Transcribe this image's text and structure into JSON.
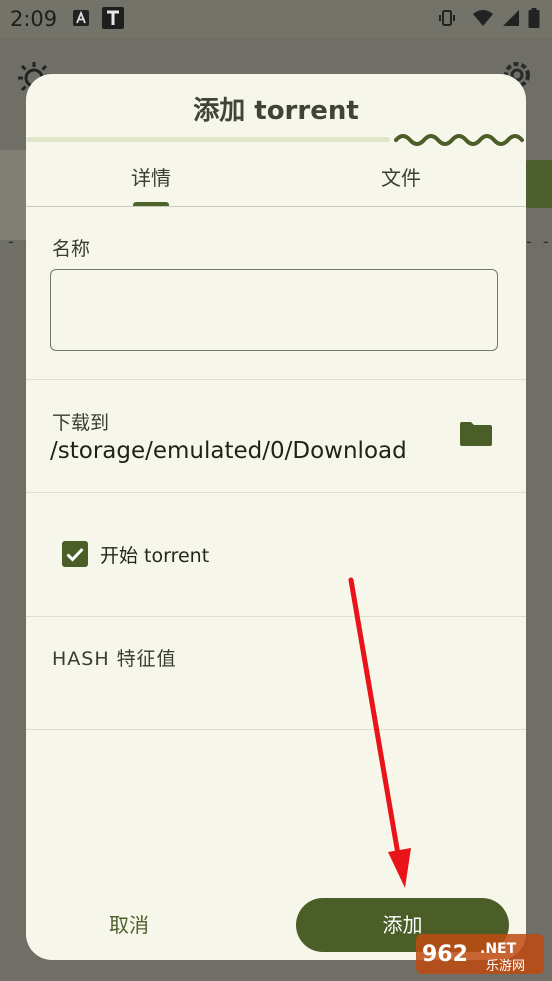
{
  "status_bar": {
    "time": "2:09",
    "left_icons": [
      "a-box-icon",
      "t-box-icon"
    ],
    "right_icons": [
      "vibrate-icon",
      "wifi-icon",
      "signal-icon",
      "battery-icon"
    ]
  },
  "background": {
    "icons": [
      "brightness-icon",
      "settings-gear-icon"
    ],
    "dashes": "- - -",
    "dashes_right": "- -"
  },
  "dialog": {
    "title": "添加 torrent",
    "tabs": [
      {
        "label": "详情",
        "selected": true
      },
      {
        "label": "文件",
        "selected": false
      }
    ],
    "name_label": "名称",
    "name_value": "",
    "download_to_label": "下载到",
    "download_path": "/storage/emulated/0/Download",
    "start_torrent_label": "开始 torrent",
    "start_torrent_checked": true,
    "hash_label": "HASH 特征值",
    "cancel_label": "取消",
    "add_label": "添加"
  },
  "colors": {
    "accent": "#4b5e28",
    "dialog_bg": "#f6f6ea",
    "scrim": "#6f6f68",
    "annotation_arrow": "#e8141a"
  },
  "watermark": {
    "brand_number": "962",
    "brand_suffix": ".NET",
    "brand_cn": "乐游网"
  }
}
